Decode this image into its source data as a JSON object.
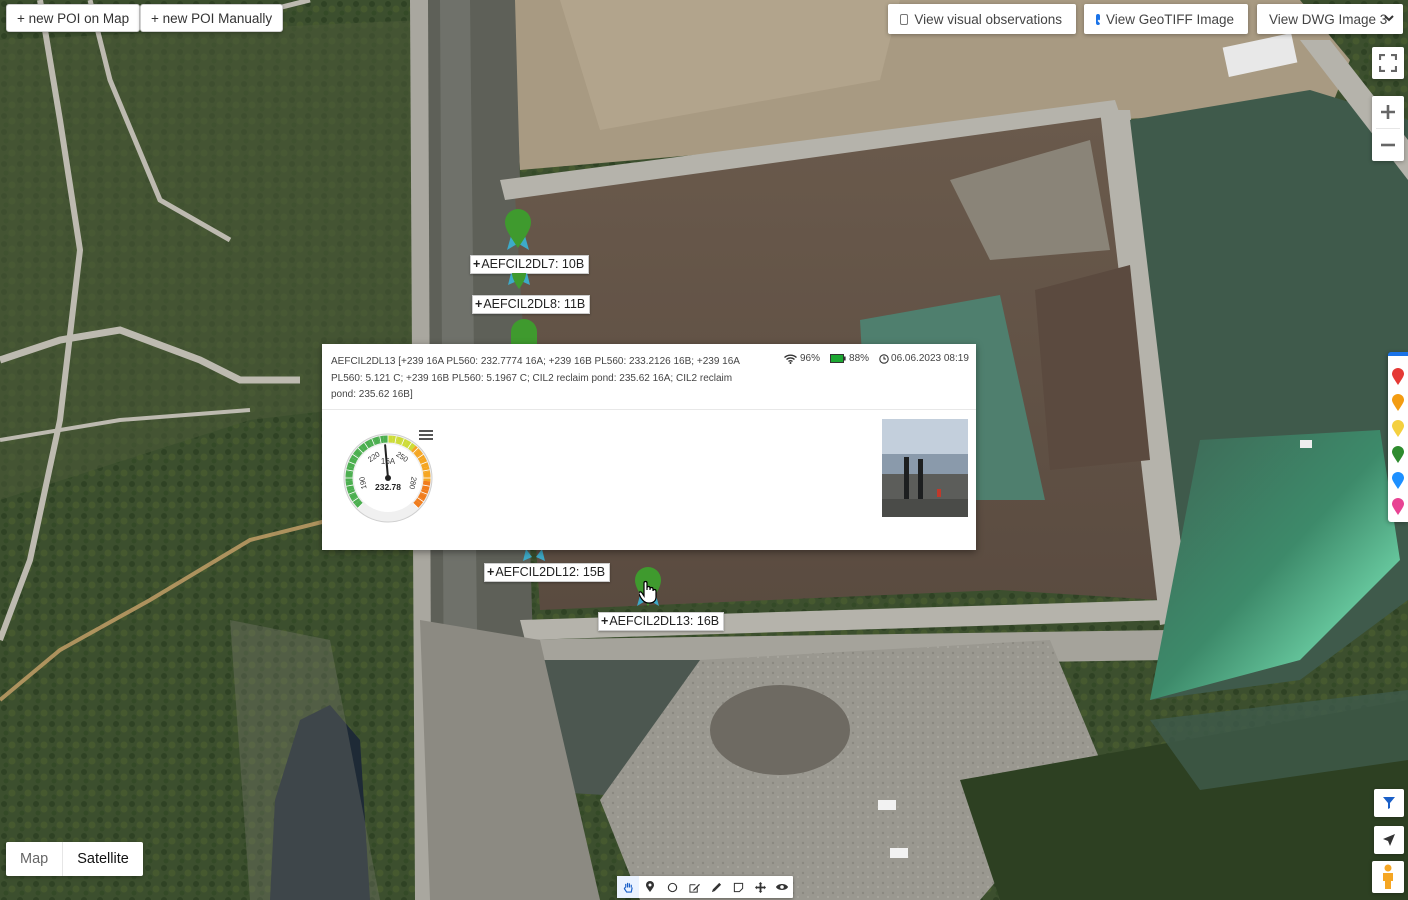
{
  "toolbar": {
    "new_poi_map": "+ new POI on Map",
    "new_poi_manual": "+ new POI Manually",
    "view_visual_observations": "View visual observations",
    "view_visual_observations_checked": false,
    "view_geotiff": "View GeoTIFF Image",
    "view_geotiff_checked": true,
    "dwg_select_value": "View DWG Image 3"
  },
  "map_type": {
    "map_label": "Map",
    "satellite_label": "Satellite",
    "selected": "Satellite"
  },
  "markers": [
    {
      "name": "AEFCIL2DL7",
      "value": "10B",
      "color": "#3f9a2e"
    },
    {
      "name": "AEFCIL2DL8",
      "value": "11B",
      "color": "#3f9a2e"
    },
    {
      "name": "AEFCIL2DL12",
      "value": "15B",
      "color": "#3f9a2e"
    },
    {
      "name": "AEFCIL2DL13",
      "value": "16B",
      "color": "#3f9a2e"
    }
  ],
  "popup": {
    "title": "AEFCIL2DL13 [+239 16A PL560: 232.7774 16A; +239 16B PL560: 233.2126 16B; +239 16A PL560: 5.121 C; +239 16B PL560: 5.1967 C; CIL2 reclaim pond: 235.62 16A; CIL2 reclaim pond: 235.62 16B]",
    "signal": "96%",
    "battery": "88%",
    "timestamp": "06.06.2023 08:19",
    "gauge": {
      "value": "232.78",
      "unit": "16A",
      "ticks": [
        "190",
        "220",
        "250",
        "280"
      ],
      "min": 175,
      "max": 295,
      "reading": 232.78
    }
  },
  "palette_colors": [
    "#e53935",
    "#f39c12",
    "#f4d03f",
    "#2e8b2e",
    "#1e90ff",
    "#e84393"
  ],
  "icons": {
    "fullscreen": "fullscreen-icon",
    "zoom_in": "plus-icon",
    "zoom_out": "minus-icon",
    "filter": "filter-icon",
    "locate": "navigation-arrow-icon",
    "pegman": "street-view-pegman-icon",
    "wifi": "wifi-icon",
    "battery": "battery-icon",
    "clock": "clock-icon",
    "menu": "hamburger-menu-icon"
  },
  "draw_tools": [
    "hand-icon",
    "marker-icon",
    "circle-icon",
    "polygon-edit-icon",
    "pencil-icon",
    "square-icon",
    "move-icon",
    "eye-icon"
  ]
}
